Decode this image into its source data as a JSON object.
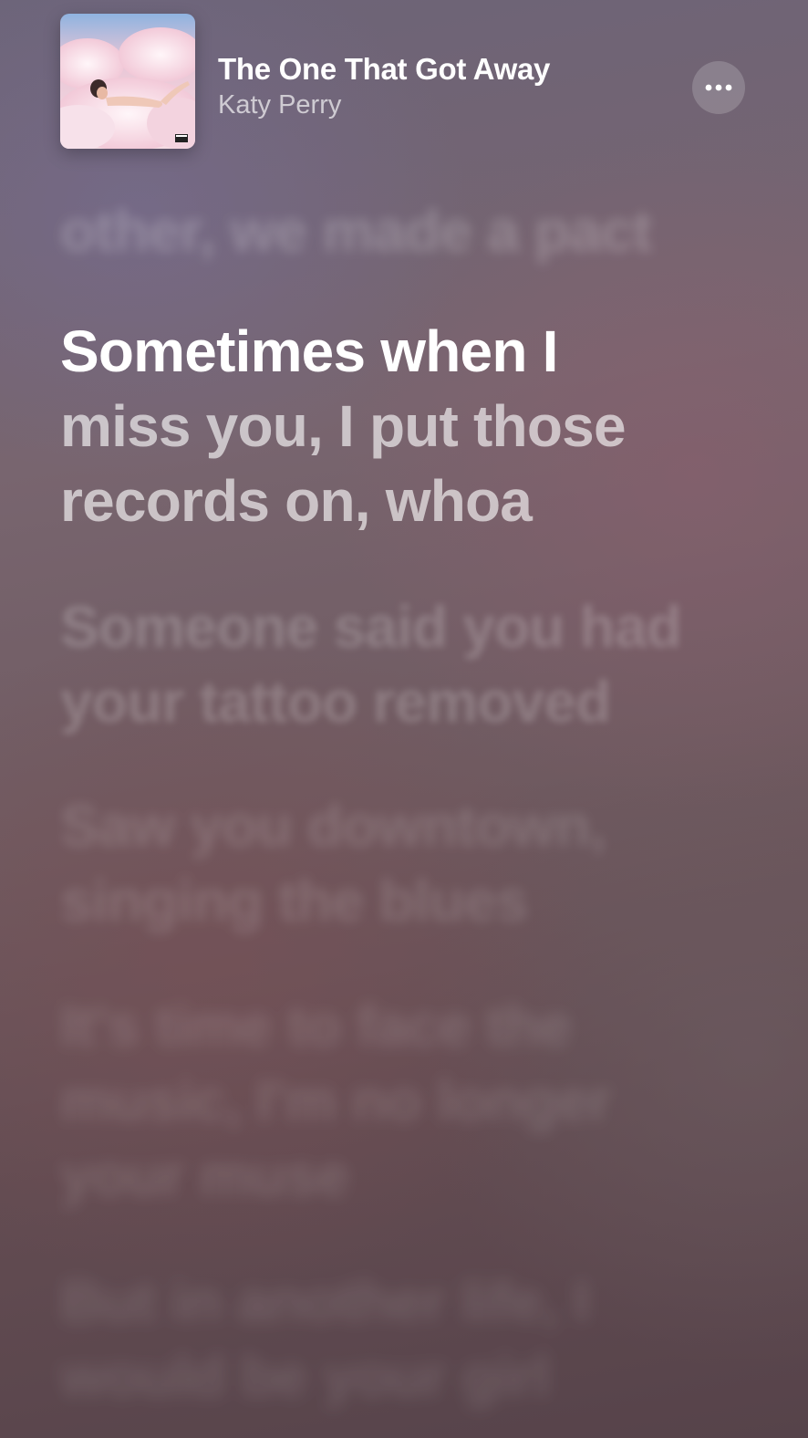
{
  "now_playing": {
    "title": "The One That Got Away",
    "artist": "Katy Perry",
    "album_art_icon": "album-cover-cloud-art",
    "more_icon": "ellipsis-icon"
  },
  "lyrics": {
    "previous": {
      "line1": "other, we made a pact"
    },
    "active": {
      "line1": "Sometimes when I",
      "line2": "miss you, I put those",
      "line3": "records on, whoa"
    },
    "upcoming": [
      {
        "line1": "Someone said you had",
        "line2": "your tattoo removed"
      },
      {
        "line1": "Saw you downtown,",
        "line2": "singing the blues"
      },
      {
        "line1": "It's time to face the",
        "line2": "music, I'm no longer",
        "line3": "your muse"
      },
      {
        "line1": "But in another life, I",
        "line2": "would be your girl"
      }
    ]
  },
  "colors": {
    "background_top": "#6c6478",
    "background_bottom": "#56434a",
    "active_text": "#ffffff"
  }
}
